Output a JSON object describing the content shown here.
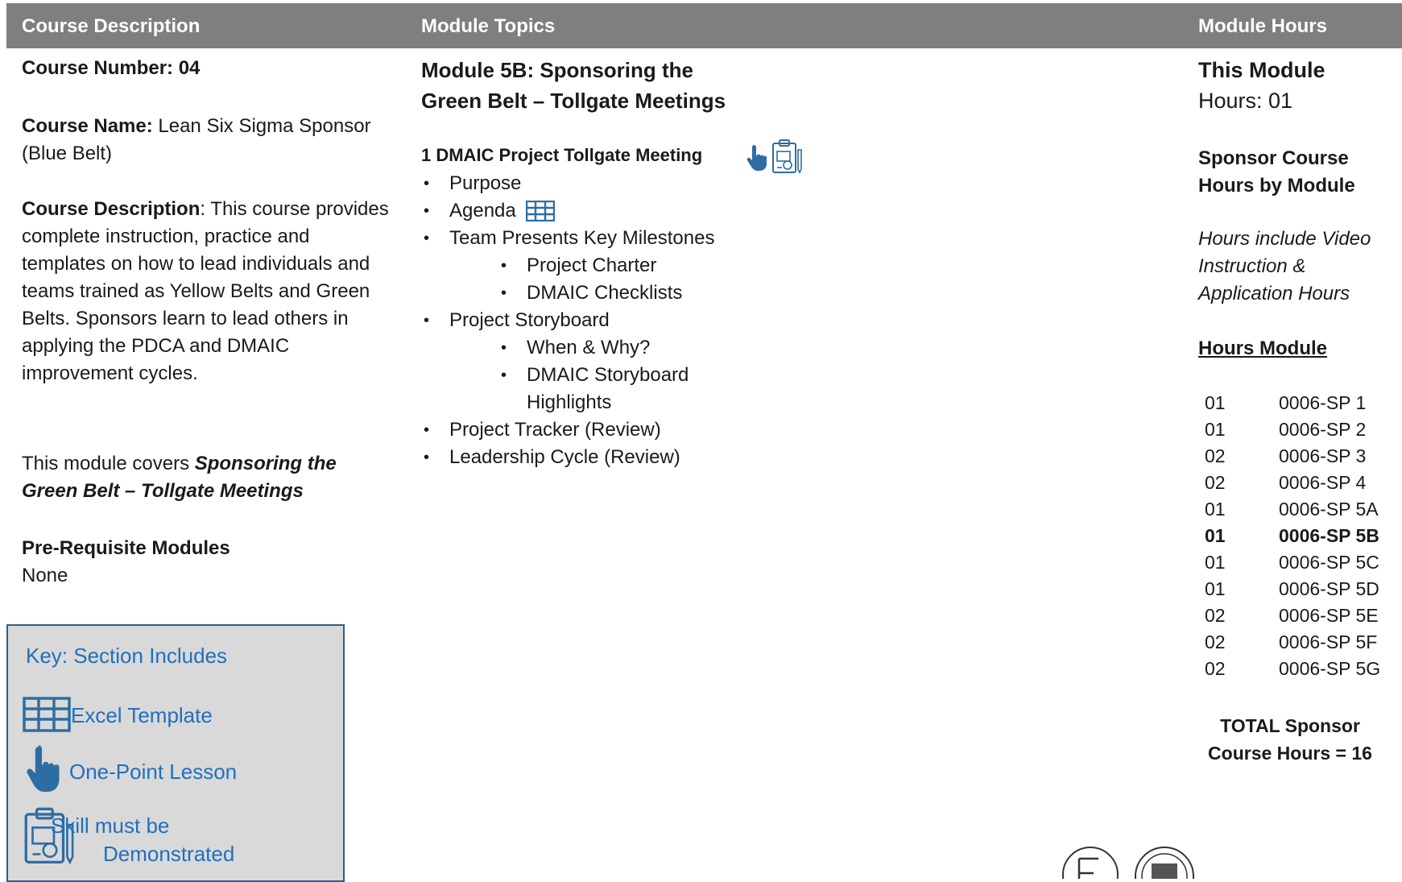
{
  "header": {
    "col1": "Course Description",
    "col2": "Module Topics",
    "col3": "Module Hours"
  },
  "left": {
    "course_number_label": "Course Number: 04",
    "course_name_label": "Course Name:",
    "course_name_value": " Lean Six Sigma Sponsor (Blue Belt)",
    "course_desc_label": "Course Description",
    "course_desc_value": ": This course provides complete instruction, practice and templates on how to lead individuals and teams trained as Yellow Belts and Green Belts. Sponsors learn to lead others in applying the PDCA and DMAIC improvement cycles.",
    "covers_prefix": "This module covers ",
    "covers_title": "Sponsoring the Green Belt – Tollgate Meetings",
    "prereq_label": "Pre-Requisite Modules",
    "prereq_value": "None"
  },
  "middle": {
    "module_title_line1": "Module 5B: Sponsoring the",
    "module_title_line2": "Green Belt – Tollgate Meetings",
    "section_title": "1 DMAIC Project Tollgate Meeting",
    "items": {
      "purpose": "Purpose",
      "agenda": "Agenda",
      "milestones": "Team Presents Key Milestones",
      "charter": "Project Charter",
      "checklists": "DMAIC Checklists",
      "storyboard": "Project Storyboard",
      "when_why": "When & Why?",
      "highlights_1": "DMAIC Storyboard",
      "highlights_2": "Highlights",
      "tracker": "Project Tracker (Review)",
      "leadership": "Leadership Cycle (Review)"
    }
  },
  "right": {
    "this_module": "This Module",
    "hours": "Hours: 01",
    "sponsor_hours_1": "Sponsor Course",
    "sponsor_hours_2": "Hours by Module",
    "note_1": "Hours include Video",
    "note_2": "Instruction &",
    "note_3": "Application Hours",
    "table_header": "Hours Module",
    "rows": [
      {
        "h": "01",
        "m": "0006-SP 1"
      },
      {
        "h": "01",
        "m": "0006-SP 2"
      },
      {
        "h": "02",
        "m": "0006-SP 3"
      },
      {
        "h": "02",
        "m": "0006-SP 4"
      },
      {
        "h": "01",
        "m": "0006-SP 5A"
      },
      {
        "h": "01",
        "m": "0006-SP 5B"
      },
      {
        "h": "01",
        "m": "0006-SP 5C"
      },
      {
        "h": "01",
        "m": "0006-SP 5D"
      },
      {
        "h": "02",
        "m": "0006-SP 5E"
      },
      {
        "h": "02",
        "m": "0006-SP 5F"
      },
      {
        "h": "02",
        "m": "0006-SP 5G"
      }
    ],
    "total_1": "TOTAL Sponsor",
    "total_2": "Course Hours = 16"
  },
  "key": {
    "title": "Key: Section Includes",
    "excel": "Excel Template",
    "opl": "One-Point Lesson",
    "skill_1": "Skill must be",
    "skill_2": "Demonstrated"
  },
  "icons": [
    "table-grid-icon",
    "pointing-hand-icon",
    "clipboard-skill-icon",
    "certification-seal-logo"
  ],
  "colors": {
    "header_bg": "#7f7f7f",
    "key_bg": "#d9d9d9",
    "accent_blue": "#1f6fbf",
    "icon_blue": "#2e6da4"
  }
}
